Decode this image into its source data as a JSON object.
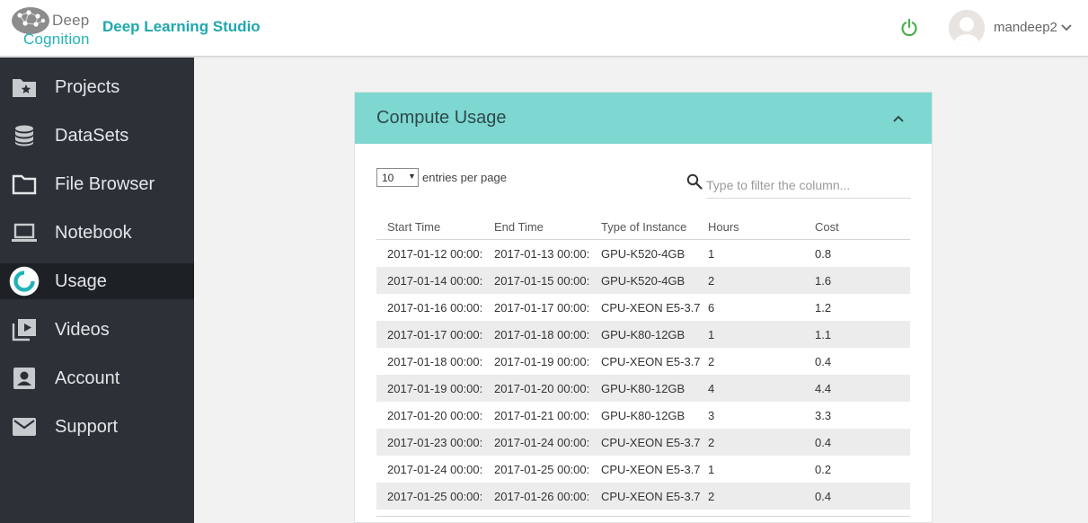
{
  "header": {
    "logo_top": "Deep",
    "logo_bottom": "Cognition",
    "app_title": "Deep Learning Studio",
    "username": "mandeep2"
  },
  "sidebar": {
    "items": [
      {
        "label": "Projects",
        "icon": "folder-star-icon"
      },
      {
        "label": "DataSets",
        "icon": "database-icon"
      },
      {
        "label": "File Browser",
        "icon": "folder-icon"
      },
      {
        "label": "Notebook",
        "icon": "laptop-icon"
      },
      {
        "label": "Usage",
        "icon": "usage-ring-icon",
        "active": true
      },
      {
        "label": "Videos",
        "icon": "video-library-icon"
      },
      {
        "label": "Account",
        "icon": "account-box-icon"
      },
      {
        "label": "Support",
        "icon": "envelope-icon"
      }
    ]
  },
  "card": {
    "title": "Compute Usage",
    "page_size": "10",
    "entries_label": "entries per page",
    "search_placeholder": "Type to filter the column...",
    "columns": [
      "Start Time",
      "End Time",
      "Type of Instance",
      "Hours",
      "Cost"
    ],
    "rows": [
      [
        "2017-01-12 00:00:",
        "2017-01-13 00:00:",
        "GPU-K520-4GB",
        "1",
        "0.8"
      ],
      [
        "2017-01-14 00:00:",
        "2017-01-15 00:00:",
        "GPU-K520-4GB",
        "2",
        "1.6"
      ],
      [
        "2017-01-16 00:00:",
        "2017-01-17 00:00:",
        "CPU-XEON E5-3.7!",
        "6",
        "1.2"
      ],
      [
        "2017-01-17 00:00:",
        "2017-01-18 00:00:",
        "GPU-K80-12GB",
        "1",
        "1.1"
      ],
      [
        "2017-01-18 00:00:",
        "2017-01-19 00:00:",
        "CPU-XEON E5-3.7!",
        "2",
        "0.4"
      ],
      [
        "2017-01-19 00:00:",
        "2017-01-20 00:00:",
        "GPU-K80-12GB",
        "4",
        "4.4"
      ],
      [
        "2017-01-20 00:00:",
        "2017-01-21 00:00:",
        "GPU-K80-12GB",
        "3",
        "3.3"
      ],
      [
        "2017-01-23 00:00:",
        "2017-01-24 00:00:",
        "CPU-XEON E5-3.7!",
        "2",
        "0.4"
      ],
      [
        "2017-01-24 00:00:",
        "2017-01-25 00:00:",
        "CPU-XEON E5-3.7!",
        "1",
        "0.2"
      ],
      [
        "2017-01-25 00:00:",
        "2017-01-26 00:00:",
        "CPU-XEON E5-3.7!",
        "2",
        "0.4"
      ]
    ]
  },
  "colors": {
    "accent": "#1fa8ad",
    "card_header": "#7ed8d1",
    "sidebar_bg": "#2c3137",
    "power_green": "#4caf50"
  }
}
